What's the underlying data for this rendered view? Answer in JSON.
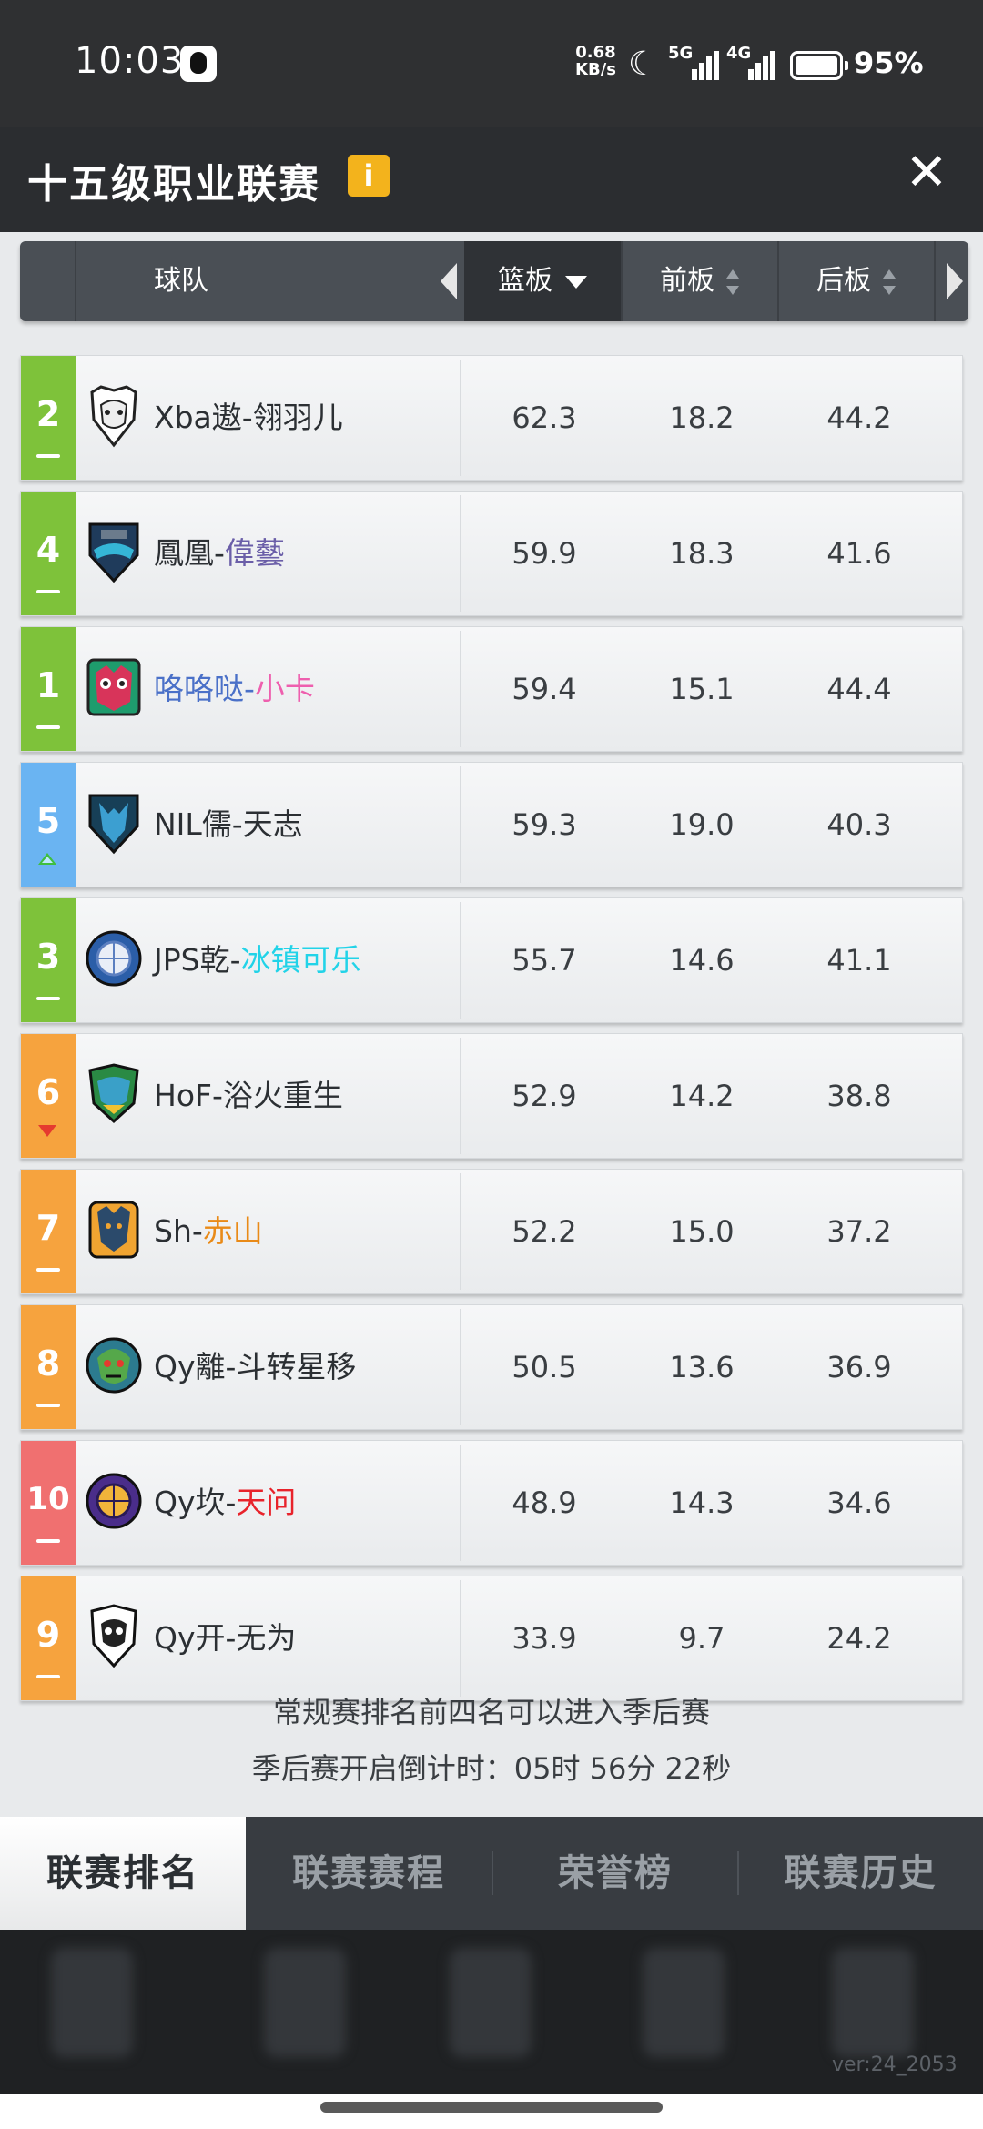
{
  "status_bar": {
    "time": "10:03",
    "net_speed_value": "0.68",
    "net_speed_unit": "KB/s",
    "signal1": "5G",
    "signal2": "4G",
    "battery": "95%"
  },
  "header": {
    "title": "十五级职业联赛",
    "info_icon": "i"
  },
  "columns": {
    "team": "球队",
    "rebounds": "篮板",
    "off_rebounds": "前板",
    "def_rebounds": "后板"
  },
  "rows": [
    {
      "rank": "2",
      "trend": "same",
      "rank_color": "#7ec23a",
      "logo": "bull-skull-logo",
      "team_main": "Xba遨-",
      "team_suffix": "翎羽儿",
      "suffix_color": "#2b2f33",
      "main_color": "#2b2f33",
      "reb": "62.3",
      "oreb": "18.2",
      "dreb": "44.2"
    },
    {
      "rank": "4",
      "trend": "same",
      "rank_color": "#7ec23a",
      "logo": "dragon-shield-logo",
      "team_main": "鳳凰-",
      "team_suffix": "偉藝",
      "suffix_color": "#6a5ea8",
      "main_color": "#2b2f33",
      "reb": "59.9",
      "oreb": "18.3",
      "dreb": "41.6"
    },
    {
      "rank": "1",
      "trend": "same",
      "rank_color": "#7ec23a",
      "logo": "owl-logo",
      "team_main": "咯咯哒-",
      "team_suffix": "小卡",
      "suffix_color": "#ee5fae",
      "main_color": "#4a70c8",
      "reb": "59.4",
      "oreb": "15.1",
      "dreb": "44.4"
    },
    {
      "rank": "5",
      "trend": "up",
      "rank_color": "#6ab4f2",
      "logo": "wolf-shield-logo",
      "team_main": "NIL儒-",
      "team_suffix": "天志",
      "suffix_color": "#2b2f33",
      "main_color": "#2b2f33",
      "reb": "59.3",
      "oreb": "19.0",
      "dreb": "40.3"
    },
    {
      "rank": "3",
      "trend": "same",
      "rank_color": "#7ec23a",
      "logo": "basketball-circle-logo",
      "team_main": "JPS乾-",
      "team_suffix": "冰镇可乐",
      "suffix_color": "#22d3e8",
      "main_color": "#2b2f33",
      "reb": "55.7",
      "oreb": "14.6",
      "dreb": "41.1"
    },
    {
      "rank": "6",
      "trend": "down",
      "rank_color": "#f6a33e",
      "logo": "dragon-head-logo",
      "team_main": "HoF-浴火重生",
      "team_suffix": "",
      "suffix_color": "#2b2f33",
      "main_color": "#2b2f33",
      "reb": "52.9",
      "oreb": "14.2",
      "dreb": "38.8"
    },
    {
      "rank": "7",
      "trend": "same",
      "rank_color": "#f6a33e",
      "logo": "tiger-badge-logo",
      "team_main": "Sh-",
      "team_suffix": "赤山",
      "suffix_color": "#e98a17",
      "main_color": "#2b2f33",
      "reb": "52.2",
      "oreb": "15.0",
      "dreb": "37.2"
    },
    {
      "rank": "8",
      "trend": "same",
      "rank_color": "#f6a33e",
      "logo": "goblin-face-logo",
      "team_main": "Qy離-斗转星移",
      "team_suffix": "",
      "suffix_color": "#2b2f33",
      "main_color": "#2b2f33",
      "reb": "50.5",
      "oreb": "13.6",
      "dreb": "36.9"
    },
    {
      "rank": "10",
      "trend": "same",
      "rank_color": "#f07070",
      "logo": "purple-ball-logo",
      "team_main": "Qy坎-",
      "team_suffix": "天问",
      "suffix_color": "#e8232b",
      "main_color": "#2b2f33",
      "reb": "48.9",
      "oreb": "14.3",
      "dreb": "34.6"
    },
    {
      "rank": "9",
      "trend": "same",
      "rank_color": "#f6a33e",
      "logo": "skull-crest-logo",
      "team_main": "Qy开-无为",
      "team_suffix": "",
      "suffix_color": "#2b2f33",
      "main_color": "#2b2f33",
      "reb": "33.9",
      "oreb": "9.7",
      "dreb": "24.2"
    }
  ],
  "notes": {
    "playoff_rule": "常规赛排名前四名可以进入季后赛",
    "countdown": "季后赛开启倒计时：05时 56分 22秒"
  },
  "tabs": [
    {
      "label": "联赛排名",
      "active": true
    },
    {
      "label": "联赛赛程",
      "active": false
    },
    {
      "label": "荣誉榜",
      "active": false
    },
    {
      "label": "联赛历史",
      "active": false
    }
  ],
  "version": "ver:24_2053"
}
